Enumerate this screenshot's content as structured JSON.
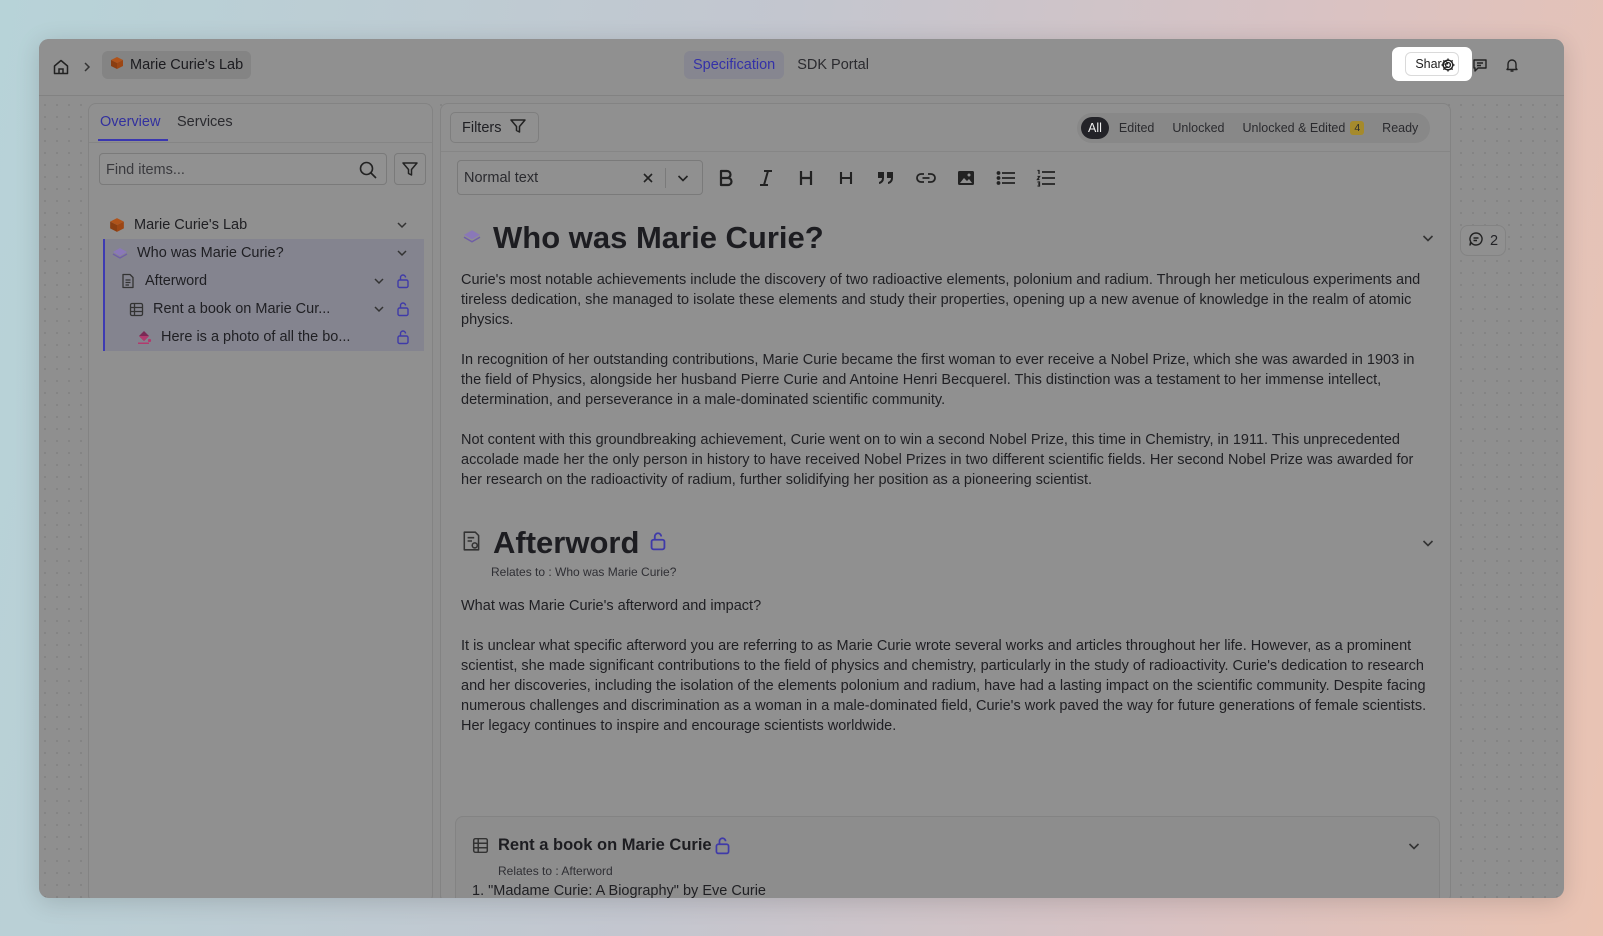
{
  "topbar": {
    "project_name": "Marie Curie's Lab",
    "tabs": [
      {
        "label": "Specification",
        "active": true
      },
      {
        "label": "SDK Portal",
        "active": false
      }
    ],
    "share_label": "Share"
  },
  "sidebar": {
    "tabs": [
      {
        "label": "Overview",
        "active": true
      },
      {
        "label": "Services",
        "active": false
      }
    ],
    "search_placeholder": "Find items...",
    "tree": [
      {
        "label": "Marie Curie's Lab",
        "icon": "cube-icon",
        "expandable": true,
        "locked": false
      },
      {
        "label": "Who was Marie Curie?",
        "icon": "layers-icon",
        "expandable": true,
        "locked": false
      },
      {
        "label": "Afterword",
        "icon": "document-icon",
        "expandable": true,
        "locked": true
      },
      {
        "label": "Rent a book on Marie Cur...",
        "icon": "table-icon",
        "expandable": true,
        "locked": true
      },
      {
        "label": "Here is a photo of all the bo...",
        "icon": "paint-bucket-icon",
        "expandable": false,
        "locked": true
      }
    ]
  },
  "editor": {
    "filters_label": "Filters",
    "status_filters": [
      {
        "label": "All",
        "active": true
      },
      {
        "label": "Edited",
        "active": false
      },
      {
        "label": "Unlocked",
        "active": false
      },
      {
        "label": "Unlocked & Edited",
        "active": false,
        "badge": "4"
      },
      {
        "label": "Ready",
        "active": false
      }
    ],
    "text_style": "Normal text",
    "sections": {
      "who": {
        "title": "Who was Marie Curie?",
        "paragraphs": [
          "Curie's most notable achievements include the discovery of two radioactive elements, polonium and radium. Through her meticulous experiments and tireless dedication, she managed to isolate these elements and study their properties, opening up a new avenue of knowledge in the realm of atomic physics.",
          "In recognition of her outstanding contributions, Marie Curie became the first woman to ever receive a Nobel Prize, which she was awarded in 1903 in the field of Physics, alongside her husband Pierre Curie and Antoine Henri Becquerel. This distinction was a testament to her immense intellect, determination, and perseverance in a male-dominated scientific community.",
          "Not content with this groundbreaking achievement, Curie went on to win a second Nobel Prize, this time in Chemistry, in 1911. This unprecedented accolade made her the only person in history to have received Nobel Prizes in two different scientific fields. Her second Nobel Prize was awarded for her research on the radioactivity of radium, further solidifying her position as a pioneering scientist."
        ]
      },
      "afterword": {
        "title": "Afterword",
        "relates": "Relates to : Who was Marie Curie?",
        "paragraphs": [
          "What was Marie Curie's afterword and impact?",
          "It is unclear what specific afterword you are referring to as Marie Curie wrote several works and articles throughout her life. However, as a prominent scientist, she made significant contributions to the field of physics and chemistry, particularly in the study of radioactivity. Curie's dedication to research and her discoveries, including the isolation of the elements polonium and radium, have had a lasting impact on the scientific community. Despite facing numerous challenges and discrimination as a woman in a male-dominated field, Curie's work paved the way for future generations of female scientists. Her legacy continues to inspire and encourage scientists worldwide."
        ]
      },
      "rent": {
        "title": "Rent a book on Marie Curie",
        "relates": "Relates to : Afterword",
        "first_line": "1. \"Madame Curie: A Biography\" by Eve Curie"
      }
    },
    "comment_count": "2"
  }
}
